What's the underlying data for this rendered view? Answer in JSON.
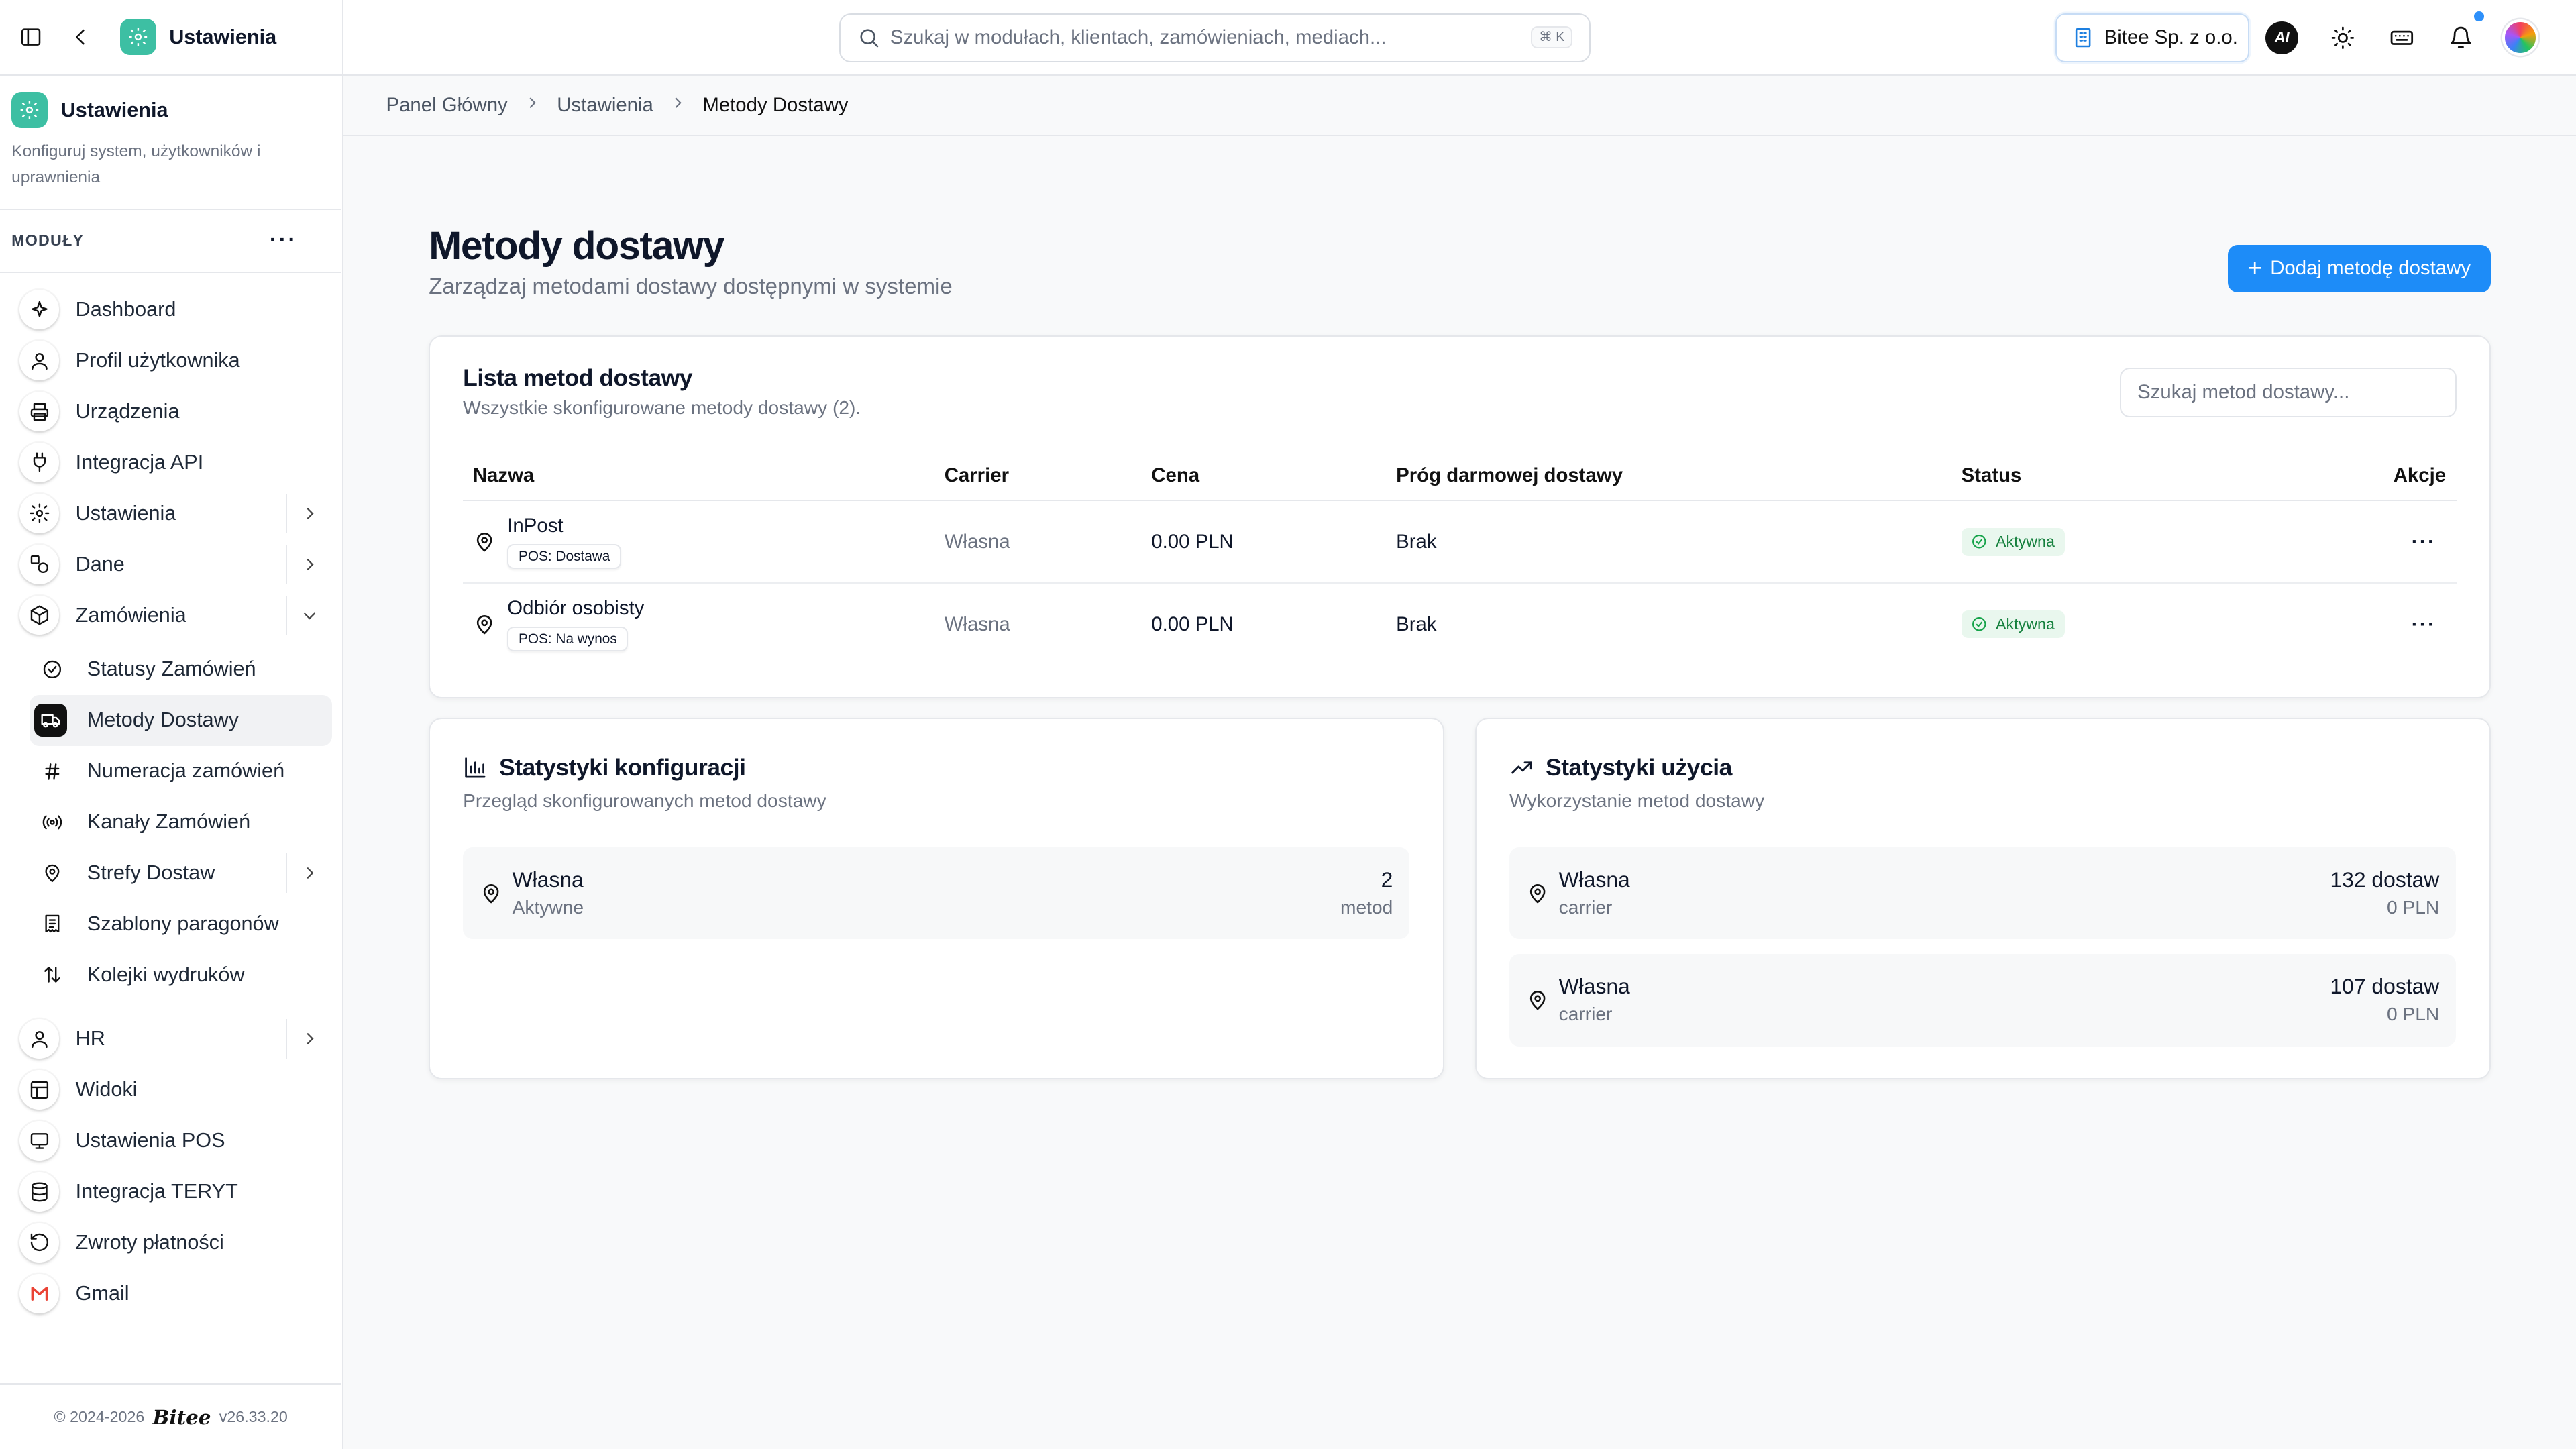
{
  "topbar": {
    "search_placeholder": "Szukaj w modułach, klientach, zamówieniach, mediach...",
    "shortcut": "⌘ K",
    "company": "Bitee Sp. z o.o.",
    "ai_label": "AI"
  },
  "sidebar": {
    "app_title": "Ustawienia",
    "section_title": "Ustawienia",
    "section_desc": "Konfiguruj system, użytkowników i uprawnienia",
    "modules_label": "MODUŁY",
    "items": [
      {
        "label": "Dashboard"
      },
      {
        "label": "Profil użytkownika"
      },
      {
        "label": "Urządzenia"
      },
      {
        "label": "Integracja API"
      },
      {
        "label": "Ustawienia"
      },
      {
        "label": "Dane"
      },
      {
        "label": "Zamówienia"
      }
    ],
    "sub_items": [
      {
        "label": "Statusy Zamówień"
      },
      {
        "label": "Metody Dostawy"
      },
      {
        "label": "Numeracja zamówień"
      },
      {
        "label": "Kanały Zamówień"
      },
      {
        "label": "Strefy Dostaw"
      },
      {
        "label": "Szablony paragonów"
      },
      {
        "label": "Kolejki wydruków"
      }
    ],
    "items_after": [
      {
        "label": "HR"
      },
      {
        "label": "Widoki"
      },
      {
        "label": "Ustawienia POS"
      },
      {
        "label": "Integracja TERYT"
      },
      {
        "label": "Zwroty płatności"
      },
      {
        "label": "Gmail"
      }
    ],
    "footer_copy": "© 2024-2026",
    "footer_brand": "Bitee",
    "footer_version": "v26.33.20"
  },
  "breadcrumb": [
    "Panel Główny",
    "Ustawienia",
    "Metody Dostawy"
  ],
  "page": {
    "title": "Metody dostawy",
    "subtitle": "Zarządzaj metodami dostawy dostępnymi w systemie",
    "add_button": "Dodaj metodę dostawy"
  },
  "list": {
    "title": "Lista metod dostawy",
    "desc": "Wszystkie skonfigurowane metody dostawy (2).",
    "search_placeholder": "Szukaj metod dostawy...",
    "columns": [
      "Nazwa",
      "Carrier",
      "Cena",
      "Próg darmowej dostawy",
      "Status",
      "Akcje"
    ],
    "rows": [
      {
        "name": "InPost",
        "pos": "POS: Dostawa",
        "carrier": "Własna",
        "price": "0.00 PLN",
        "threshold": "Brak",
        "status": "Aktywna"
      },
      {
        "name": "Odbiór osobisty",
        "pos": "POS: Na wynos",
        "carrier": "Własna",
        "price": "0.00 PLN",
        "threshold": "Brak",
        "status": "Aktywna"
      }
    ]
  },
  "config_stats": {
    "title": "Statystyki konfiguracji",
    "desc": "Przegląd skonfigurowanych metod dostawy",
    "rows": [
      {
        "name": "Własna",
        "sub": "Aktywne",
        "value": "2",
        "unit": "metod"
      }
    ]
  },
  "usage_stats": {
    "title": "Statystyki użycia",
    "desc": "Wykorzystanie metod dostawy",
    "rows": [
      {
        "name": "Własna",
        "sub": "carrier",
        "value": "132 dostaw",
        "amount": "0 PLN"
      },
      {
        "name": "Własna",
        "sub": "carrier",
        "value": "107 dostaw",
        "amount": "0 PLN"
      }
    ]
  },
  "colors": {
    "accent": "#1d8cf8",
    "brand_tile": "#3dbfa3",
    "status_bg": "#e9f7ee",
    "status_fg": "#15803d"
  }
}
